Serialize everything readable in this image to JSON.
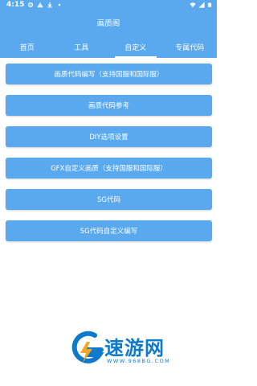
{
  "status_bar": {
    "time": "4:15",
    "icons": [
      "settings-icon",
      "warning-icon",
      "download-icon",
      "dot-icon",
      "wifi-icon",
      "signal-icon",
      "battery-icon"
    ]
  },
  "app_bar": {
    "title": "画质阁"
  },
  "tabs": [
    {
      "label": "首页",
      "selected": false
    },
    {
      "label": "工具",
      "selected": false
    },
    {
      "label": "自定义",
      "selected": true
    },
    {
      "label": "专属代码",
      "selected": false
    }
  ],
  "buttons": [
    {
      "label": "画质代码编写（支持国服和国际服）"
    },
    {
      "label": "画质代码参考"
    },
    {
      "label": "DIY选项设置"
    },
    {
      "label": "GFX自定义画质（支持国服和国际服）"
    },
    {
      "label": "SG代码"
    },
    {
      "label": "SG代码自定义编写"
    }
  ],
  "watermark": {
    "text": "速游网",
    "url": "WWW.968BG.COM"
  },
  "colors": {
    "primary": "#5aa9ef",
    "watermark": "#0f7ac9"
  }
}
